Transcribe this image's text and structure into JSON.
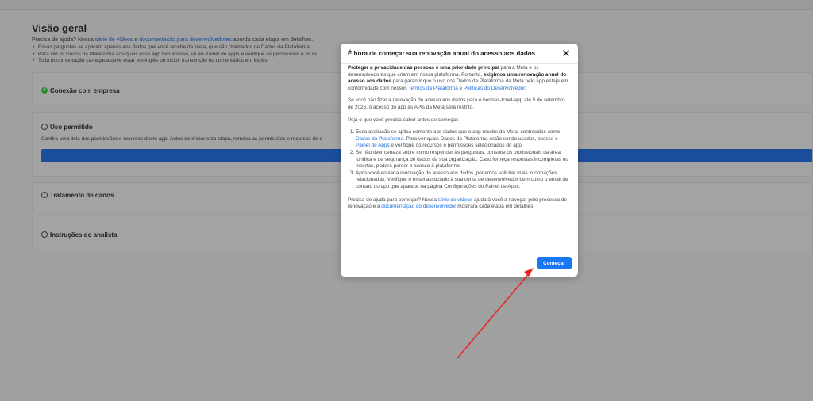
{
  "overview": {
    "title": "Visão geral",
    "help_prefix": "Precisa de ajuda? Nossa ",
    "help_link_videos": "série de vídeos",
    "help_mid": " e ",
    "help_link_docs": "documentação para desenvolvedores",
    "help_suffix": " aborda cada etapa em detalhes.",
    "bullets": [
      "Essas perguntas se aplicam apenas aos dados que você recebe da Meta, que são chamados de Dados da Plataforma.",
      "Para ver os Dados da Plataforma aos quais esse app tem acesso, vá ao Painel de Apps e verifique as permissões e os re",
      "Toda documentação carregada deve estar em inglês ou incluir transcrição ou comentários em inglês."
    ]
  },
  "sections": {
    "company": "Conexão com empresa",
    "allowed_use": "Uso permitido",
    "allowed_use_desc": "Confira uma lista das permissões e recursos deste app. Antes de iniciar esta etapa, remova as permissões e recursos de q",
    "data_handling": "Tratamento de dados",
    "analyst": "Instruções do analista"
  },
  "modal": {
    "title": "É hora de começar sua renovação anual do acesso aos dados",
    "p1_b1": "Proteger a privacidade das pessoas é uma prioridade principal",
    "p1_t1": " para a Meta e os desenvolvedores que criam em nossa plataforma. Portanto, ",
    "p1_b2": "exigimos uma renovação anual do acesso aos dados",
    "p1_t2": " para garantir que o uso dos Dados da Plataforma da Meta pelo app esteja em conformidade com nossos ",
    "p1_l1": "Termos da Plataforma",
    "p1_t3": " e ",
    "p1_l2": "Políticas do Desenvolvedor",
    "p1_t4": ".",
    "p2": "Se você não fizer a renovação do acesso aos dados para o hermes-tcnet-app até 5 de setembro de 2025, o acesso do app às APIs da Meta será restrito.",
    "p3": "Veja o que você precisa saber antes de começar:",
    "li1_t1": "Essa avaliação se aplica somente aos dados que o app recebe da Meta, conhecidos como ",
    "li1_l1": "Dados da Plataforma",
    "li1_t2": ". Para ver quais Dados da Plataforma estão sendo usados, acesse o ",
    "li1_l2": "Painel de Apps",
    "li1_t3": " e verifique os recursos e permissões selecionados do app.",
    "li2": "Se não tiver certeza sobre como responder às perguntas, consulte os profissionais da área jurídica e de segurança de dados da sua organização. Caso forneça respostas incompletas ou incertas, poderá perder o acesso à plataforma.",
    "li3": "Após você enviar a renovação do acesso aos dados, podemos solicitar mais informações relacionadas. Verifique o email associado à sua conta de desenvolvedor bem como o email de contato do app que aparece na página Configurações do Painel de Apps.",
    "p4_t1": "Precisa de ajuda para começar? Nossa ",
    "p4_l1": "série de vídeos",
    "p4_t2": " ajudará você a navegar pelo processo de renovação e a ",
    "p4_l2": "documentação do desenvolvedor",
    "p4_t3": " mostrará cada etapa em detalhes.",
    "button": "Começar"
  },
  "colors": {
    "primary": "#1877f2",
    "link": "#216fdb",
    "arrow": "#e8241c",
    "check": "#2f8a3a"
  }
}
